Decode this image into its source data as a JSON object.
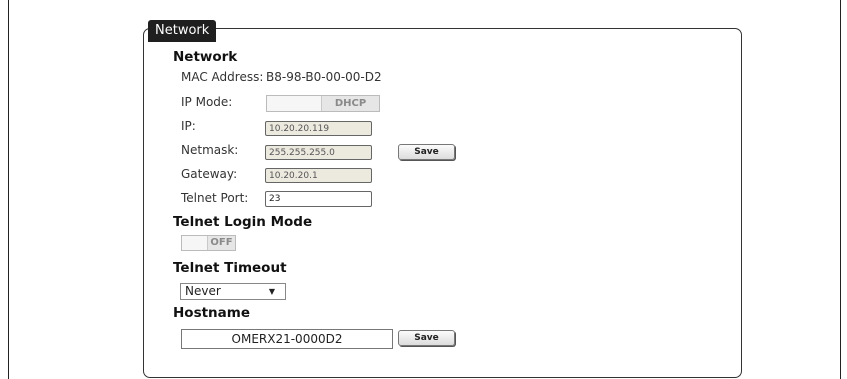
{
  "panel": {
    "tab_title": "Network"
  },
  "network": {
    "heading": "Network",
    "mac_label": "MAC Address:",
    "mac_value": "B8-98-B0-00-00-D2",
    "ip_mode_label": "IP Mode:",
    "ip_mode_value": "DHCP",
    "ip_label": "IP:",
    "ip_value": "10.20.20.119",
    "netmask_label": "Netmask:",
    "netmask_value": "255.255.255.0",
    "gateway_label": "Gateway:",
    "gateway_value": "10.20.20.1",
    "telnet_port_label": "Telnet Port:",
    "telnet_port_value": "23",
    "save_label": "Save"
  },
  "telnet_login": {
    "heading": "Telnet Login Mode",
    "toggle_value": "OFF"
  },
  "telnet_timeout": {
    "heading": "Telnet Timeout",
    "selected": "Never"
  },
  "hostname": {
    "heading": "Hostname",
    "value": "OMERX21-0000D2",
    "save_label": "Save"
  }
}
